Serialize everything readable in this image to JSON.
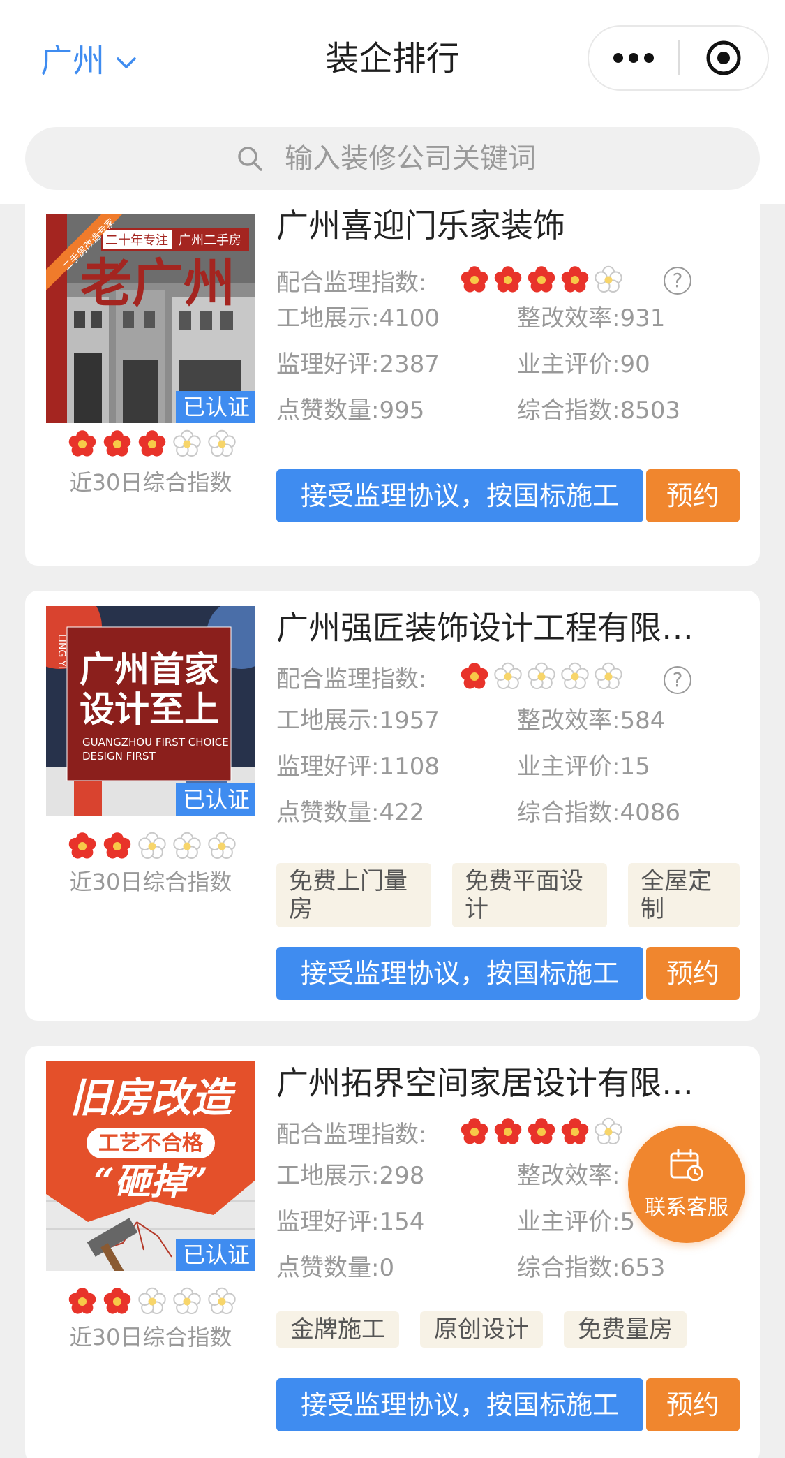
{
  "nav": {
    "city": "广州",
    "title": "装企排行"
  },
  "search": {
    "placeholder": "输入装修公司关键词"
  },
  "labels": {
    "monitor_index": "配合监理指数:",
    "site_show": "工地展示:",
    "rectify_eff": "整改效率:",
    "monitor_praise": "监理好评:",
    "owner_eval": "业主评价:",
    "likes": "点赞数量:",
    "overall": "综合指数:",
    "recent30": "近30日综合指数",
    "certified": "已认证",
    "agree_btn": "接受监理协议，按国标施工",
    "book_btn": "预约",
    "help": "?"
  },
  "companies": [
    {
      "name": "广州喜迎门乐家装饰",
      "monitor_stars": 4,
      "recent_stars": 3,
      "site_show": "4100",
      "rectify_eff": "931",
      "monitor_praise": "2387",
      "owner_eval": "90",
      "likes": "995",
      "overall": "8503",
      "tags": [],
      "image_text": {
        "line1": "二十年专注",
        "line2": "广州二手房",
        "big": "老广州",
        "ribbon": "二手房改造专家"
      }
    },
    {
      "name": "广州强匠装饰设计工程有限…",
      "monitor_stars": 1,
      "recent_stars": 2,
      "site_show": "1957",
      "rectify_eff": "584",
      "monitor_praise": "1108",
      "owner_eval": "15",
      "likes": "422",
      "overall": "4086",
      "tags": [
        "免费上门量房",
        "免费平面设计",
        "全屋定制"
      ],
      "image_text": {
        "big1": "广州首家",
        "big2": "设计至上",
        "en1": "GUANGZHOU FIRST CHOICE",
        "en2": "DESIGN FIRST",
        "side": "LING YI"
      }
    },
    {
      "name": "广州拓界空间家居设计有限…",
      "monitor_stars": 4,
      "recent_stars": 2,
      "site_show": "298",
      "rectify_eff": "",
      "monitor_praise": "154",
      "owner_eval": "5",
      "likes": "0",
      "overall": "653",
      "tags": [
        "金牌施工",
        "原创设计",
        "免费量房"
      ],
      "image_text": {
        "big": "旧房改造",
        "sub": "工艺不合格",
        "quote": "“砸掉”"
      }
    }
  ],
  "fab": {
    "label": "联系客服"
  },
  "colors": {
    "accent": "#3f8cf0",
    "orange": "#f0862e",
    "star": "#e8332a"
  }
}
